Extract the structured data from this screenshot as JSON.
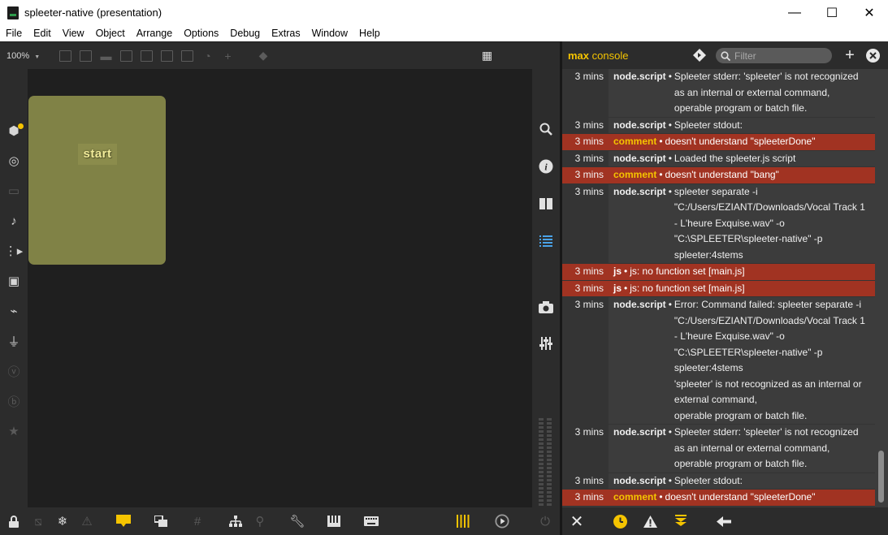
{
  "window": {
    "title": "spleeter-native (presentation)",
    "minimize": "—",
    "maximize": "☐",
    "close": "✕"
  },
  "menu": [
    "File",
    "Edit",
    "View",
    "Object",
    "Arrange",
    "Options",
    "Debug",
    "Extras",
    "Window",
    "Help"
  ],
  "patcher_toolbar": {
    "zoom": "100%",
    "zoom_caret": "▼"
  },
  "canvas": {
    "start_button": "start"
  },
  "console": {
    "title_bold": "max",
    "title_rest": "console",
    "filter_placeholder": "Filter",
    "rows": [
      {
        "time": "3 mins",
        "obj": "node.script",
        "msg": "Spleeter stderr: 'spleeter' is not recognized\nas an internal or external command,\noperable program or batch file.",
        "error": false
      },
      {
        "time": "3 mins",
        "obj": "node.script",
        "msg": "Spleeter stdout:",
        "error": false
      },
      {
        "time": "3 mins",
        "obj": "comment",
        "msg": "doesn't understand \"spleeterDone\"",
        "error": true
      },
      {
        "time": "3 mins",
        "obj": "node.script",
        "msg": "Loaded the spleeter.js script",
        "error": false
      },
      {
        "time": "3 mins",
        "obj": "comment",
        "msg": "doesn't understand \"bang\"",
        "error": true
      },
      {
        "time": "3 mins",
        "obj": "node.script",
        "msg": "spleeter separate -i\n\"C:/Users/EZIANT/Downloads/Vocal Track 1\n- L'heure Exquise.wav\" -o\n\"C:\\SPLEETER\\spleeter-native\" -p\nspleeter:4stems",
        "error": false
      },
      {
        "time": "3 mins",
        "obj": "js",
        "msg": "js: no function set [main.js]",
        "error": true
      },
      {
        "time": "3 mins",
        "obj": "js",
        "msg": "js: no function set [main.js]",
        "error": true
      },
      {
        "time": "3 mins",
        "obj": "node.script",
        "msg": "Error: Command failed: spleeter separate -i\n\"C:/Users/EZIANT/Downloads/Vocal Track 1\n- L'heure Exquise.wav\" -o\n\"C:\\SPLEETER\\spleeter-native\" -p\nspleeter:4stems\n'spleeter' is not recognized as an internal or\nexternal command,\noperable program or batch file.",
        "error": false
      },
      {
        "time": "3 mins",
        "obj": "node.script",
        "msg": "Spleeter stderr: 'spleeter' is not recognized\nas an internal or external command,\noperable program or batch file.",
        "error": false
      },
      {
        "time": "3 mins",
        "obj": "node.script",
        "msg": "Spleeter stdout:",
        "error": false
      },
      {
        "time": "3 mins",
        "obj": "comment",
        "msg": "doesn't understand \"spleeterDone\"",
        "error": true
      }
    ]
  },
  "colors": {
    "accent": "#f5c400",
    "error_row": "#a13322",
    "panel": "#808246"
  }
}
